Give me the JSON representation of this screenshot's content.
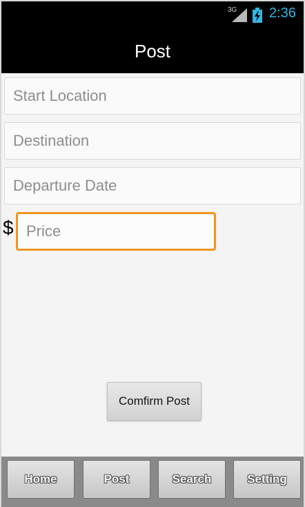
{
  "status_bar": {
    "network": "3G",
    "time": "2:36",
    "time_color": "#33b5e5",
    "signal_icon": "signal-icon",
    "battery_icon": "battery-charging-icon"
  },
  "title_bar": {
    "title": "Post"
  },
  "form": {
    "start_location": {
      "placeholder": "Start Location",
      "value": ""
    },
    "destination": {
      "placeholder": "Destination",
      "value": ""
    },
    "departure_date": {
      "placeholder": "Departure Date",
      "value": ""
    },
    "price": {
      "currency_symbol": "$",
      "placeholder": "Price",
      "value": "",
      "focused": true,
      "focus_color": "#f0961e"
    },
    "confirm_label": "Comfirm Post"
  },
  "tabs": [
    {
      "label": "Home"
    },
    {
      "label": "Post"
    },
    {
      "label": "Search"
    },
    {
      "label": "Setting"
    }
  ]
}
